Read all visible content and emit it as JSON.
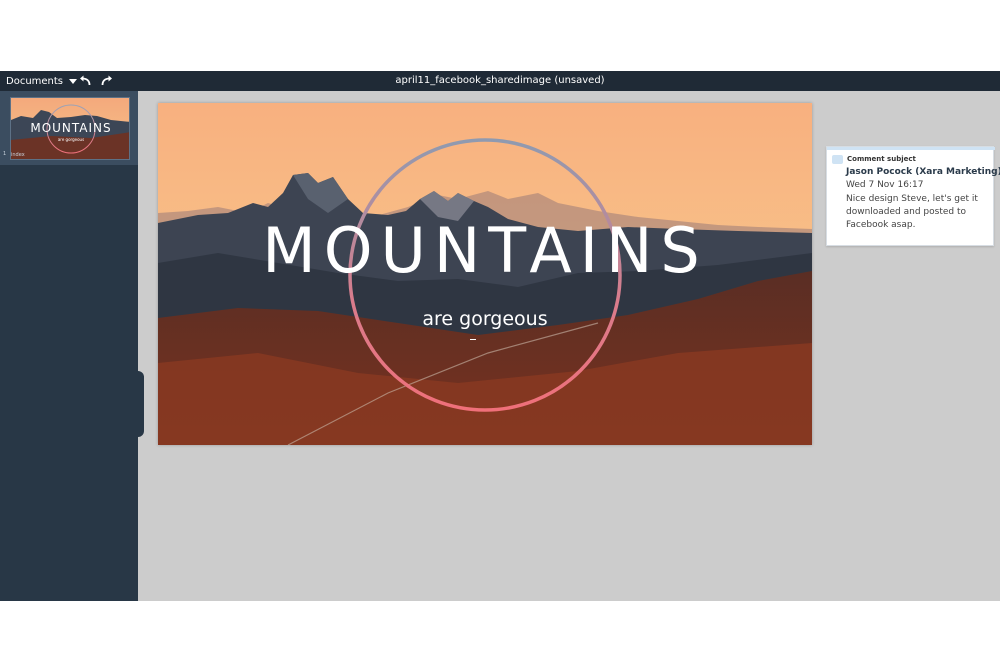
{
  "toolbar": {
    "documents_label": "Documents",
    "document_title": "april11_facebook_sharedimage (unsaved)"
  },
  "pages": {
    "items": [
      {
        "number": "1",
        "label": "index"
      }
    ]
  },
  "design": {
    "heading": "MOUNTAINS",
    "subheading": "are gorgeous"
  },
  "comment": {
    "subject": "Comment subject",
    "author": "Jason Pocock (Xara Marketing)",
    "separator": "|",
    "date": "Wed 7 Nov 16:17",
    "body": "Nice design Steve, let's get it downloaded and posted to Facebook asap."
  },
  "colors": {
    "toolbar_bg": "#1f2a36",
    "panel_bg": "#283746",
    "canvas_bg": "#cccccc",
    "sky_top": "#f6b07a",
    "ring_top": "#9aa3b7",
    "ring_bottom": "#f0707a"
  },
  "icons": {
    "undo": "undo-icon",
    "redo": "redo-icon",
    "documents_dropdown": "caret-down-icon",
    "comment": "comment-icon"
  }
}
